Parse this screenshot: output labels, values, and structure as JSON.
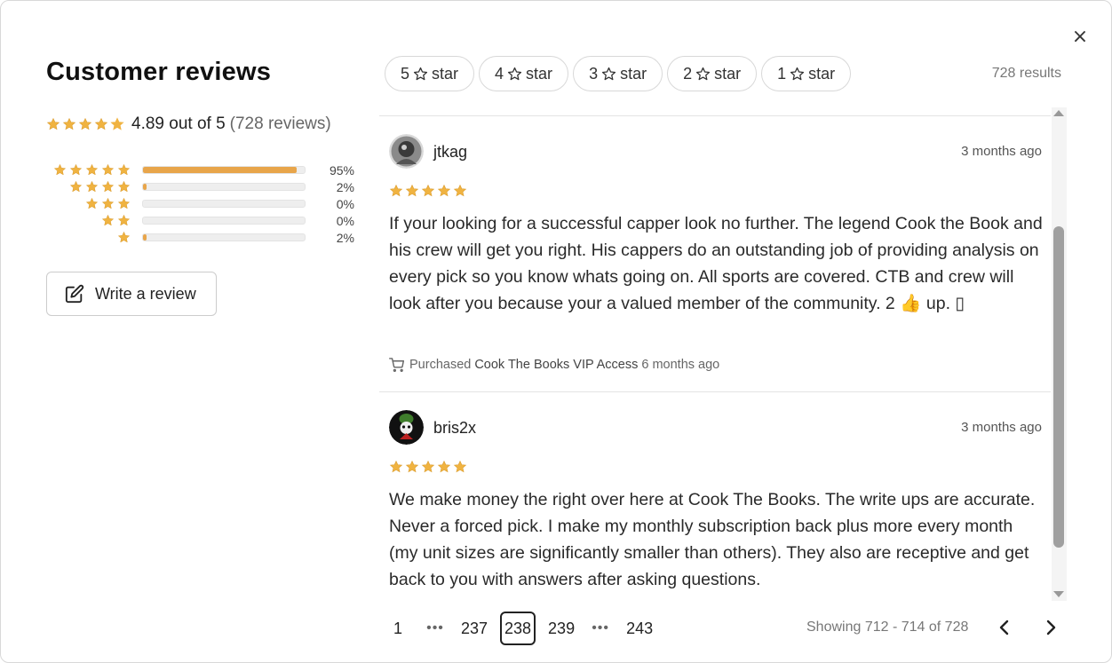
{
  "modal": {
    "close_label": "×"
  },
  "summary": {
    "title": "Customer reviews",
    "average_text": "4.89 out of 5",
    "count_text": "(728 reviews)",
    "average_rating": 4.89
  },
  "distribution": [
    {
      "stars": 5,
      "percent_label": "95%",
      "fraction": 0.95
    },
    {
      "stars": 4,
      "percent_label": "2%",
      "fraction": 0.02
    },
    {
      "stars": 3,
      "percent_label": "0%",
      "fraction": 0.0
    },
    {
      "stars": 2,
      "percent_label": "0%",
      "fraction": 0.0
    },
    {
      "stars": 1,
      "percent_label": "2%",
      "fraction": 0.02
    }
  ],
  "write_review": {
    "label": "Write a review",
    "icon": "edit-icon"
  },
  "filters": [
    {
      "num": "5",
      "word": "star"
    },
    {
      "num": "4",
      "word": "star"
    },
    {
      "num": "3",
      "word": "star"
    },
    {
      "num": "2",
      "word": "star"
    },
    {
      "num": "1",
      "word": "star"
    }
  ],
  "results_text": "728 results",
  "reviews": [
    {
      "username": "jtkag",
      "date": "3 months ago",
      "rating": 5,
      "text": "If your looking for a successful capper look no further. The legend Cook the Book and his crew will get you right. His cappers do an outstanding job of providing analysis on every pick so you know whats going on. All sports are covered. CTB and crew will look after you because your a valued member of the community. 2 👍 up. ▯",
      "purchase_prefix": "Purchased",
      "purchase_product": "Cook The Books VIP Access",
      "purchase_time": "6 months ago"
    },
    {
      "username": "bris2x",
      "date": "3 months ago",
      "rating": 5,
      "text": "We make money the right over here at Cook The Books. The write ups are accurate. Never a forced pick. I make my monthly subscription back plus more every month (my unit sizes are significantly smaller than others). They also are receptive and get back to you with answers after asking questions."
    }
  ],
  "pagination": {
    "pages": [
      "1",
      "•••",
      "237",
      "238",
      "239",
      "•••",
      "243"
    ],
    "current": "238",
    "showing_text": "Showing 712 - 714 of 728"
  },
  "colors": {
    "star": "#f0b341",
    "bar_fill": "#e8a54a"
  }
}
